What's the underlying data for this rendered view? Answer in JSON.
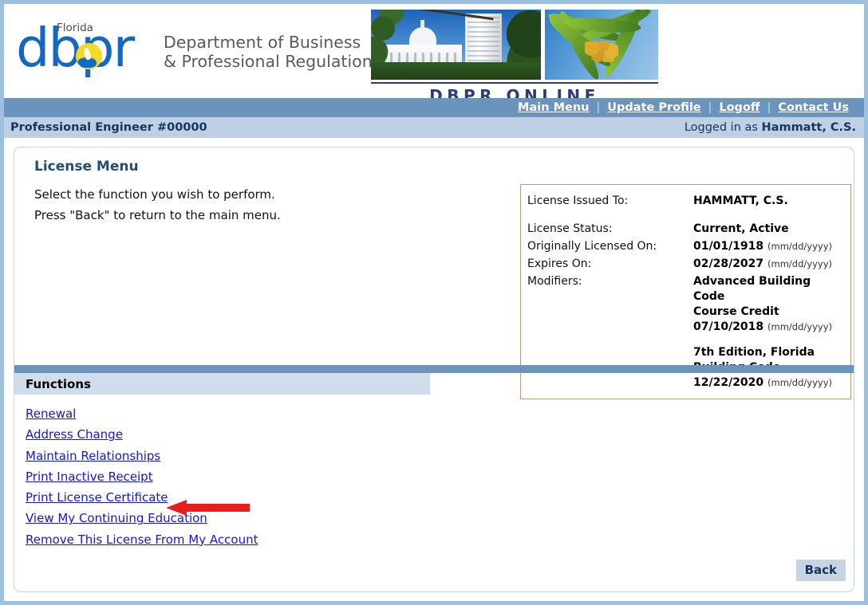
{
  "header": {
    "logo": {
      "florida": "Florida",
      "dbpr": "dbpr",
      "dept_line1": "Department of Business",
      "dept_line2": "& Professional Regulation"
    },
    "banner_title": "DBPR ONLINE SERVICES"
  },
  "nav": {
    "links": [
      {
        "label": "Main Menu"
      },
      {
        "label": "Update Profile"
      },
      {
        "label": "Logoff"
      },
      {
        "label": "Contact Us"
      }
    ],
    "separator": "|"
  },
  "infobar": {
    "license_title": "Professional Engineer #00000",
    "logged_in_prefix": "Logged in as ",
    "logged_in_user": "Hammatt, C.S."
  },
  "main": {
    "page_title": "License Menu",
    "intro_line1": "Select the function you wish to perform.",
    "intro_line2": "Press \"Back\" to return to the main menu."
  },
  "license_box": {
    "issued_to_label": "License Issued To:",
    "issued_to_value": "HAMMATT, C.S.",
    "status_label": "License Status:",
    "status_value": "Current, Active",
    "originally_licensed_label": "Originally Licensed On:",
    "originally_licensed_value": "01/01/1918",
    "originally_licensed_format": "(mm/dd/yyyy)",
    "expires_label": "Expires On:",
    "expires_value": "02/28/2027",
    "expires_format": "(mm/dd/yyyy)",
    "modifiers_label": "Modifiers:",
    "modifiers": [
      {
        "line1": "Advanced Building Code",
        "line2": "Course Credit",
        "date": "07/10/2018",
        "format": "(mm/dd/yyyy)"
      },
      {
        "line1": "7th Edition, Florida",
        "line2": "Building Code",
        "date": "12/22/2020",
        "format": "(mm/dd/yyyy)"
      }
    ]
  },
  "functions": {
    "header": "Functions",
    "items": [
      {
        "label": "Renewal"
      },
      {
        "label": "Address Change"
      },
      {
        "label": "Maintain Relationships"
      },
      {
        "label": "Print Inactive Receipt"
      },
      {
        "label": "Print License Certificate"
      },
      {
        "label": "View My Continuing Education"
      },
      {
        "label": "Remove This License From My Account"
      }
    ]
  },
  "annotation": {
    "arrow_color": "#e81e1e",
    "points_at": "Print License Certificate"
  },
  "footer": {
    "back_label": "Back"
  },
  "colors": {
    "nav_bar": "#6a94bd",
    "info_bar": "#bdd0e4",
    "link": "#1717cf",
    "title": "#1f4e79",
    "license_border": "#b9a06a",
    "functions_header": "#cfdded"
  }
}
